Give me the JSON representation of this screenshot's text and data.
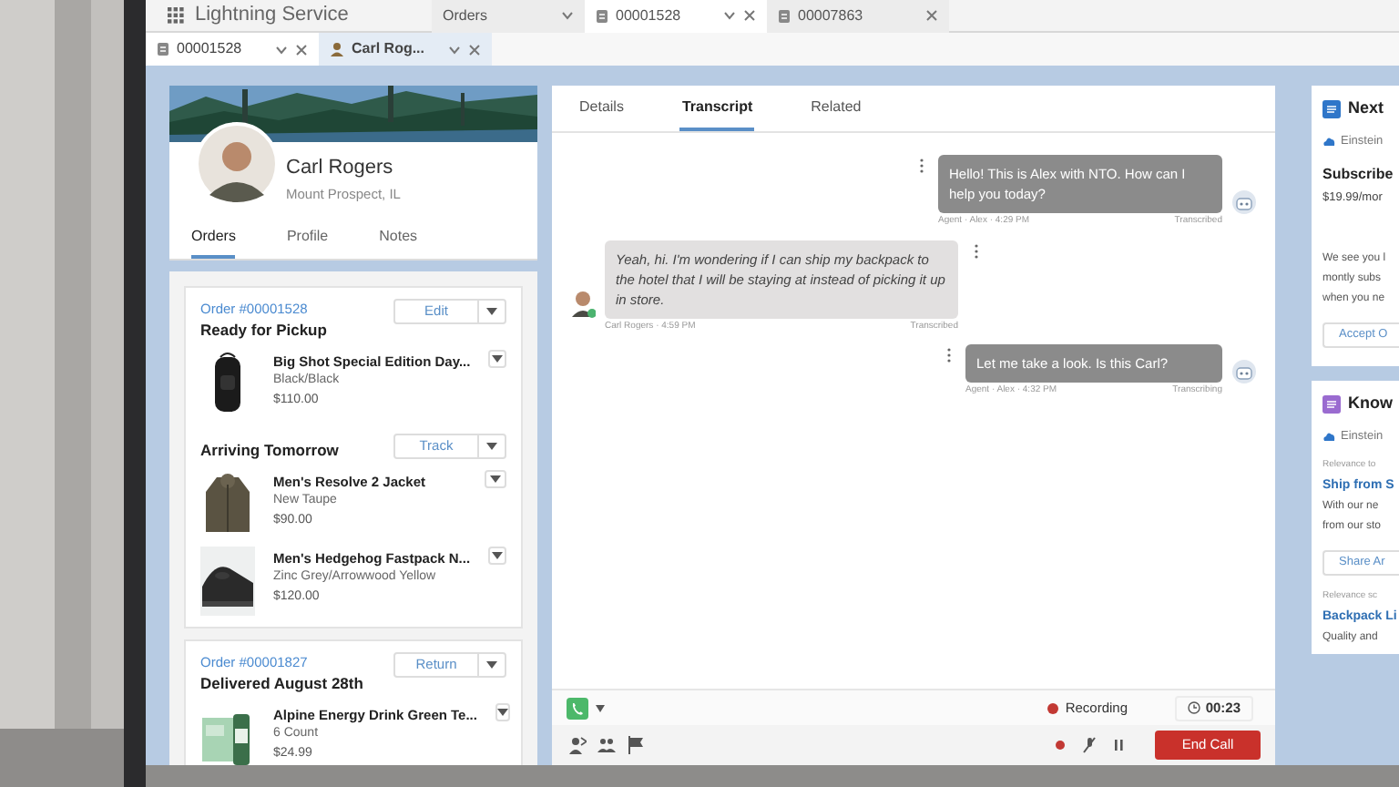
{
  "app": {
    "title": "Lightning Service"
  },
  "workspace_tabs": [
    {
      "label": "Orders",
      "kind": "nav",
      "selected": false
    },
    {
      "label": "00001528",
      "kind": "record",
      "selected": true
    },
    {
      "label": "00007863",
      "kind": "record",
      "selected": false
    }
  ],
  "subtabs": [
    {
      "label": "00001528",
      "kind": "record",
      "selected": false
    },
    {
      "label": "Carl Rog...",
      "kind": "person",
      "selected": true
    }
  ],
  "profile": {
    "name": "Carl Rogers",
    "location": "Mount Prospect, IL",
    "tabs": [
      {
        "label": "Orders",
        "selected": true
      },
      {
        "label": "Profile",
        "selected": false
      },
      {
        "label": "Notes",
        "selected": false
      }
    ]
  },
  "orders": [
    {
      "link": "Order #00001528",
      "groups": [
        {
          "title": "Ready for Pickup",
          "action": "Edit",
          "items": [
            {
              "name": "Big Shot Special Edition Day...",
              "variant": "Black/Black",
              "price": "$110.00"
            }
          ]
        },
        {
          "title": "Arriving Tomorrow",
          "action": "Track",
          "items": [
            {
              "name": "Men's Resolve 2 Jacket",
              "variant": "New Taupe",
              "price": "$90.00"
            },
            {
              "name": "Men's Hedgehog Fastpack N...",
              "variant": "Zinc Grey/Arrowwood Yellow",
              "price": "$120.00"
            }
          ]
        }
      ]
    },
    {
      "link": "Order #00001827",
      "groups": [
        {
          "title": "Delivered August 28th",
          "action": "Return",
          "items": [
            {
              "name": "Alpine Energy Drink Green Te...",
              "variant": "6 Count",
              "price": "$24.99"
            }
          ]
        }
      ]
    }
  ],
  "transcript": {
    "tabs": [
      {
        "label": "Details",
        "selected": false
      },
      {
        "label": "Transcript",
        "selected": true
      },
      {
        "label": "Related",
        "selected": false
      }
    ],
    "messages": [
      {
        "kind": "agent",
        "text": "Hello! This is Alex with NTO. How can I help you today?",
        "meta": "Agent · Alex · 4:29 PM",
        "status": "Transcribed"
      },
      {
        "kind": "customer",
        "text": "Yeah, hi. I'm wondering if I can ship my backpack to the hotel that I will be staying at instead of picking it up in store.",
        "meta": "Carl Rogers · 4:59 PM",
        "status": "Transcribed"
      },
      {
        "kind": "agent",
        "text": "Let me take a look. Is this Carl?",
        "meta": "Agent · Alex · 4:32 PM",
        "status": "Transcribing"
      }
    ]
  },
  "call": {
    "recording": "Recording",
    "timer": "00:23",
    "end_button": "End Call"
  },
  "right_cards": [
    {
      "lines": [
        {
          "kind": "header",
          "text": "Next"
        },
        {
          "kind": "source",
          "text": "Einstein"
        },
        {
          "kind": "title",
          "text": "Subscribe"
        },
        {
          "kind": "sub",
          "text": "$19.99/mor"
        },
        {
          "kind": "gap",
          "text": "We see you l"
        },
        {
          "kind": "body",
          "text": "montly subs"
        },
        {
          "kind": "body",
          "text": "when you ne"
        },
        {
          "kind": "button",
          "text": "Accept O"
        }
      ]
    },
    {
      "lines": [
        {
          "kind": "header",
          "text": "Know"
        },
        {
          "kind": "source",
          "text": "Einstein"
        },
        {
          "kind": "relevance",
          "text": "Relevance to"
        },
        {
          "kind": "link",
          "text": "Ship from S"
        },
        {
          "kind": "body",
          "text": "With our ne"
        },
        {
          "kind": "body",
          "text": "from our sto"
        },
        {
          "kind": "button",
          "text": "Share Ar"
        },
        {
          "kind": "relevance",
          "text": "Relevance sc"
        },
        {
          "kind": "link",
          "text": "Backpack Li"
        },
        {
          "kind": "body",
          "text": "Quality and"
        }
      ]
    }
  ]
}
